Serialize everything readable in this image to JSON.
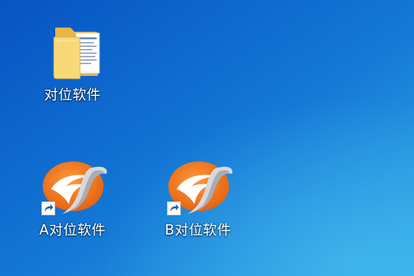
{
  "desktop": {
    "colors": {
      "background_top": "#0a5fc9",
      "background_bottom": "#2aa0e6",
      "folder_front": "#f7d774",
      "folder_back": "#e8b84a",
      "logo_orange": "#f07a1a",
      "logo_orange_dark": "#d9540c"
    },
    "icons": [
      {
        "label": "对位软件",
        "type": "folder",
        "icon": "folder-icon"
      },
      {
        "label": "A对位软件",
        "type": "shortcut",
        "icon": "app-logo-icon"
      },
      {
        "label": "B对位软件",
        "type": "shortcut",
        "icon": "app-logo-icon"
      }
    ]
  }
}
